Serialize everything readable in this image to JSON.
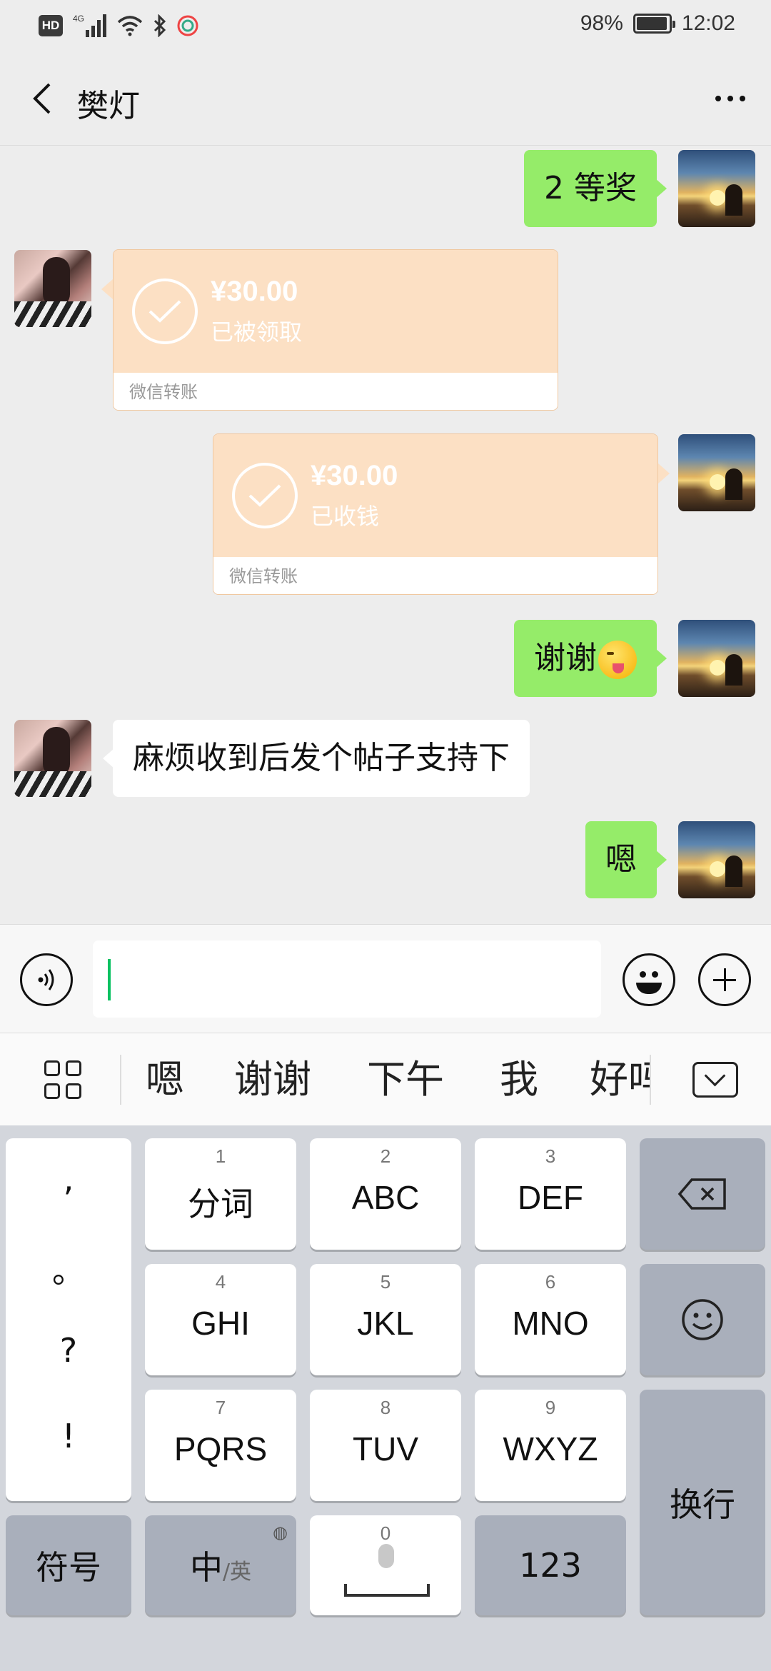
{
  "status_bar": {
    "hd": "HD",
    "network": "4G",
    "battery": "98%",
    "battery_level": 0.98,
    "time": "12:02"
  },
  "nav": {
    "title": "樊灯"
  },
  "messages": [
    {
      "from": "me",
      "type": "text",
      "text": "2 等奖"
    },
    {
      "from": "other",
      "type": "transfer",
      "amount": "¥30.00",
      "status": "已被领取",
      "footer": "微信转账"
    },
    {
      "from": "me",
      "type": "transfer",
      "amount": "¥30.00",
      "status": "已收钱",
      "footer": "微信转账"
    },
    {
      "from": "me",
      "type": "text",
      "text": "谢谢",
      "emoji": "winking-face-tongue"
    },
    {
      "from": "other",
      "type": "text",
      "text": "麻烦收到后发个帖子支持下"
    },
    {
      "from": "me",
      "type": "text",
      "text": "嗯"
    }
  ],
  "input": {
    "value": ""
  },
  "candidates": [
    "嗯",
    "谢谢",
    "下午",
    "我",
    "好吗"
  ],
  "keyboard": {
    "punct": [
      ",",
      "。",
      "?",
      "!"
    ],
    "keys": [
      {
        "num": "1",
        "label": "分词"
      },
      {
        "num": "2",
        "label": "ABC"
      },
      {
        "num": "3",
        "label": "DEF"
      },
      {
        "num": "4",
        "label": "GHI"
      },
      {
        "num": "5",
        "label": "JKL"
      },
      {
        "num": "6",
        "label": "MNO"
      },
      {
        "num": "7",
        "label": "PQRS"
      },
      {
        "num": "8",
        "label": "TUV"
      },
      {
        "num": "9",
        "label": "WXYZ"
      }
    ],
    "symbols": "符号",
    "lang_main": "中",
    "lang_alt": "/英",
    "space_num": "0",
    "num_mode": "123",
    "enter": "换行"
  },
  "colors": {
    "my_bubble": "#95ec69",
    "transfer": "#fce0c4",
    "cursor": "#07c160"
  }
}
